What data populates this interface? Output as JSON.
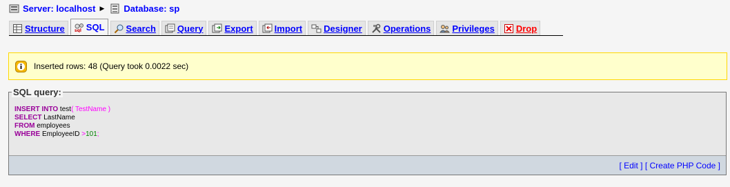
{
  "breadcrumb": {
    "server_label": "Server: localhost",
    "server_icon": "server-icon",
    "database_label": "Database: sp",
    "database_icon": "database-icon"
  },
  "tabs": [
    {
      "label": "Structure",
      "icon": "structure-icon",
      "active": false
    },
    {
      "label": "SQL",
      "icon": "sql-icon",
      "active": true
    },
    {
      "label": "Search",
      "icon": "search-icon",
      "active": false
    },
    {
      "label": "Query",
      "icon": "query-icon",
      "active": false
    },
    {
      "label": "Export",
      "icon": "export-icon",
      "active": false
    },
    {
      "label": "Import",
      "icon": "import-icon",
      "active": false
    },
    {
      "label": "Designer",
      "icon": "designer-icon",
      "active": false
    },
    {
      "label": "Operations",
      "icon": "operations-icon",
      "active": false
    },
    {
      "label": "Privileges",
      "icon": "privileges-icon",
      "active": false
    },
    {
      "label": "Drop",
      "icon": "drop-icon",
      "active": false
    }
  ],
  "notice": {
    "message": "Inserted rows: 48 (Query took 0.0022 sec)",
    "icon": "info-icon"
  },
  "sql_query": {
    "legend": "SQL query:",
    "lines": [
      {
        "kw": "INSERT INTO",
        "rest": " test",
        "extra": "( TestName )"
      },
      {
        "kw": "SELECT",
        "rest": " LastName",
        "extra": ""
      },
      {
        "kw": "FROM",
        "rest": " employees",
        "extra": ""
      },
      {
        "kw": "WHERE",
        "rest": " EmployeeID ",
        "op": ">",
        "num": "101",
        "tail": ";"
      }
    ],
    "edit_label": "Edit",
    "create_php_label": "Create PHP Code"
  },
  "colors": {
    "link": "#0000ff",
    "drop": "#ff0000",
    "notice_bg": "#ffffcc",
    "notice_border": "#ffd700",
    "keyword": "#990099"
  }
}
